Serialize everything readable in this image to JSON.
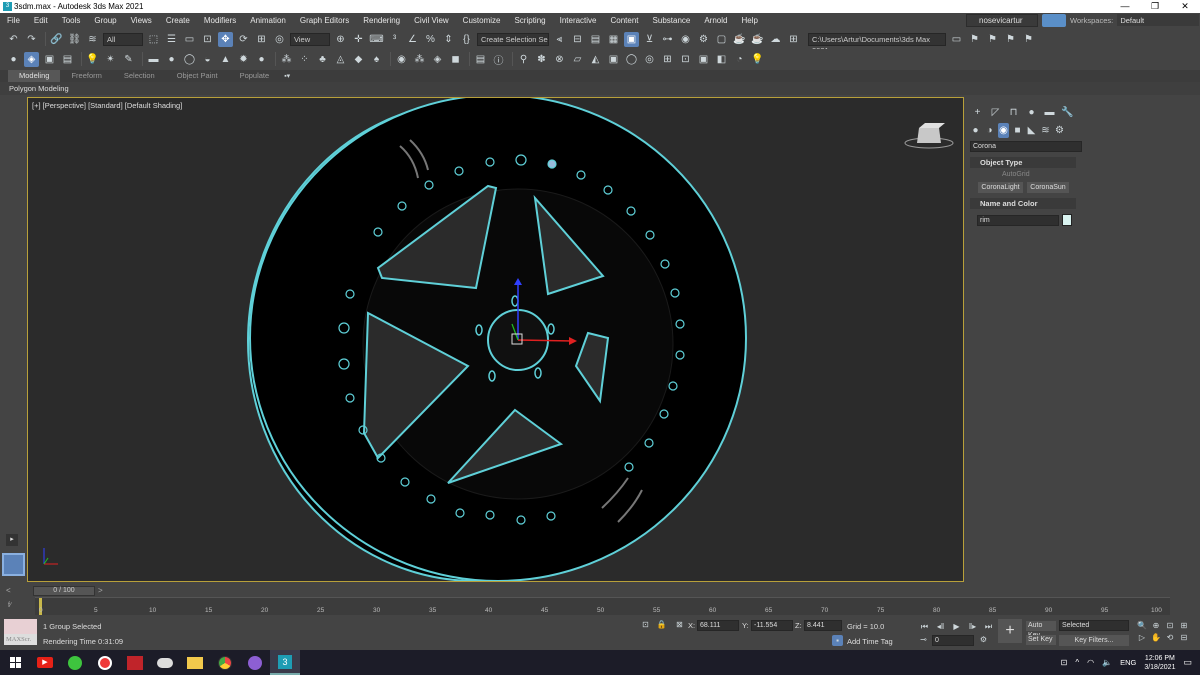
{
  "window": {
    "title": "3sdm.max - Autodesk 3ds Max 2021",
    "min": "—",
    "restore": "❐",
    "close": "✕"
  },
  "menu": [
    "File",
    "Edit",
    "Tools",
    "Group",
    "Views",
    "Create",
    "Modifiers",
    "Animation",
    "Graph Editors",
    "Rendering",
    "Civil View",
    "Customize",
    "Scripting",
    "Interactive",
    "Content",
    "Substance",
    "Arnold",
    "Help"
  ],
  "user": {
    "name": "nosevicartur",
    "workspaces_label": "Workspaces:",
    "workspace": "Default"
  },
  "toolbar": {
    "selection_filter": "All",
    "ref_coord": "View",
    "named_selection": "Create Selection Se",
    "project_path": "C:\\Users\\Artur\\Documents\\3ds Max 2021"
  },
  "ribbon": {
    "tabs": [
      "Modeling",
      "Freeform",
      "Selection",
      "Object Paint",
      "Populate"
    ],
    "active": "Modeling",
    "panel": "Polygon Modeling"
  },
  "viewport": {
    "label": "[+] [Perspective] [Standard] [Default Shading]",
    "accent": "#5fd0d8",
    "border": "#b8a03a"
  },
  "command_panel": {
    "renderer": "Corona",
    "object_type_title": "Object Type",
    "autogrid": "AutoGrid",
    "buttons": [
      "CoronaLight",
      "CoronaSun"
    ],
    "name_color_title": "Name and Color",
    "object_name": "rim",
    "swatch_color": "#d9f3f0"
  },
  "timeline": {
    "slider": "0 / 100",
    "ticks": [
      "0",
      "5",
      "10",
      "15",
      "20",
      "25",
      "30",
      "35",
      "40",
      "45",
      "50",
      "55",
      "60",
      "65",
      "70",
      "75",
      "80",
      "85",
      "90",
      "95",
      "100"
    ]
  },
  "status": {
    "maxscript": "MAXScr.",
    "selected": "1 Group Selected",
    "render_time": "Rendering Time  0:31:09",
    "x_label": "X:",
    "x": "68.111",
    "y_label": "Y:",
    "y": "-11.554",
    "z_label": "Z:",
    "z": "8.441",
    "grid": "Grid = 10.0",
    "add_time_tag": "Add Time Tag",
    "auto_key": "Auto Key",
    "set_key": "Set Key",
    "key_mode": "Selected",
    "key_filters": "Key Filters...",
    "frame": "0"
  },
  "taskbar": {
    "lang": "ENG",
    "time": "12:06 PM",
    "date": "3/18/2021"
  }
}
